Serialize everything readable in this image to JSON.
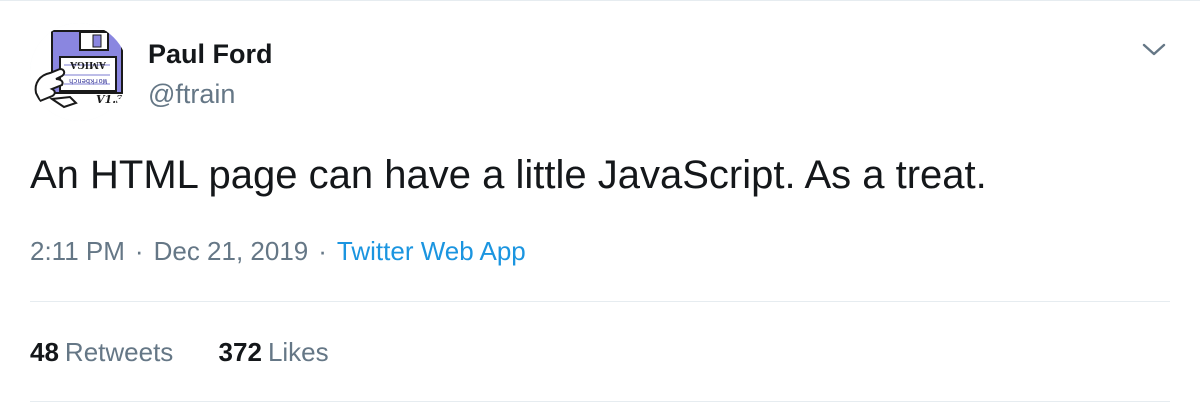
{
  "user": {
    "name": "Paul Ford",
    "handle": "@ftrain",
    "avatar_text": {
      "brand": "AMIGA",
      "app": "Workbench",
      "version": "V1.3"
    }
  },
  "tweet": {
    "text": "An HTML page can have a little JavaScript. As a treat.",
    "time": "2:11 PM",
    "date": "Dec 21, 2019",
    "separator": "·",
    "source": "Twitter Web App"
  },
  "stats": {
    "retweets_count": "48",
    "retweets_label": "Retweets",
    "likes_count": "372",
    "likes_label": "Likes"
  },
  "colors": {
    "text": "#14171a",
    "secondary": "#657786",
    "link": "#1b95e0",
    "divider": "#e6ecf0",
    "avatar_disk": "#8a86e0"
  },
  "icons": {
    "menu": "chevron-down-icon",
    "avatar": "amiga-workbench-disk-avatar"
  }
}
